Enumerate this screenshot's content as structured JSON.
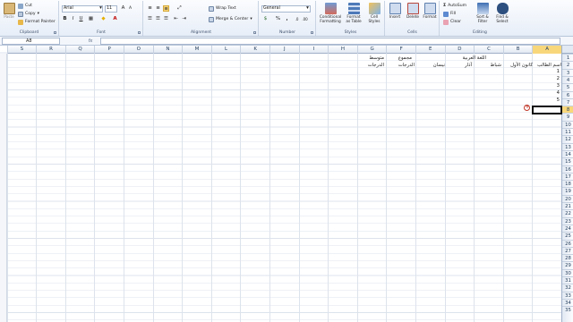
{
  "ribbon": {
    "clipboard": {
      "paste": "Paste",
      "cut": "Cut",
      "copy": "Copy",
      "format_painter": "Format Painter",
      "group": "Clipboard"
    },
    "font": {
      "name": "Arial",
      "size": "11",
      "group": "Font"
    },
    "alignment": {
      "wrap_text": "Wrap Text",
      "merge_center": "Merge & Center",
      "group": "Alignment"
    },
    "number": {
      "format": "General",
      "percent": "%",
      "comma": ",",
      "group": "Number"
    },
    "styles": {
      "conditional": "Conditional Formatting",
      "format_table": "Format as Table",
      "cell_styles": "Cell Styles",
      "group": "Styles"
    },
    "cells": {
      "insert": "Insert",
      "delete": "Delete",
      "format": "Format",
      "group": "Cells"
    },
    "editing": {
      "autosum": "AutoSum",
      "fill": "Fill",
      "clear": "Clear",
      "sort_filter": "Sort & Filter",
      "find_select": "Find & Select",
      "group": "Editing"
    }
  },
  "formula_bar": {
    "name_box": "A8",
    "fx": "fx",
    "content": ""
  },
  "columns": [
    "A",
    "B",
    "C",
    "D",
    "E",
    "F",
    "G",
    "H",
    "I",
    "J",
    "K",
    "L",
    "M",
    "N",
    "O",
    "P",
    "Q",
    "R",
    "S"
  ],
  "rows": [
    "1",
    "2",
    "3",
    "4",
    "5",
    "6",
    "7",
    "8",
    "9",
    "10",
    "11",
    "12",
    "13",
    "14",
    "15",
    "16",
    "17",
    "18",
    "19",
    "20",
    "21",
    "22",
    "23",
    "24",
    "25",
    "26",
    "27",
    "28",
    "29",
    "30",
    "31",
    "32",
    "33",
    "34",
    "35"
  ],
  "active": {
    "column": "A",
    "row": "8"
  },
  "cells": {
    "a2": "اسم الطالب",
    "b2": "كانون الأول",
    "c2": "شباط",
    "d1": "اللغة العربية",
    "d2": "آذار",
    "e2": "نيسان",
    "f1": "مجموع",
    "f2": "الدرجات",
    "g1": "متوسط",
    "g2": "الدرجات",
    "a3": "1",
    "a4": "2",
    "a5": "3",
    "a6": "4",
    "a7": "5"
  },
  "colors": {
    "accent": "#f8d77b",
    "grid": "#dde3ec",
    "header": "#27415f",
    "ribbon_bg": "#e7eef8"
  }
}
